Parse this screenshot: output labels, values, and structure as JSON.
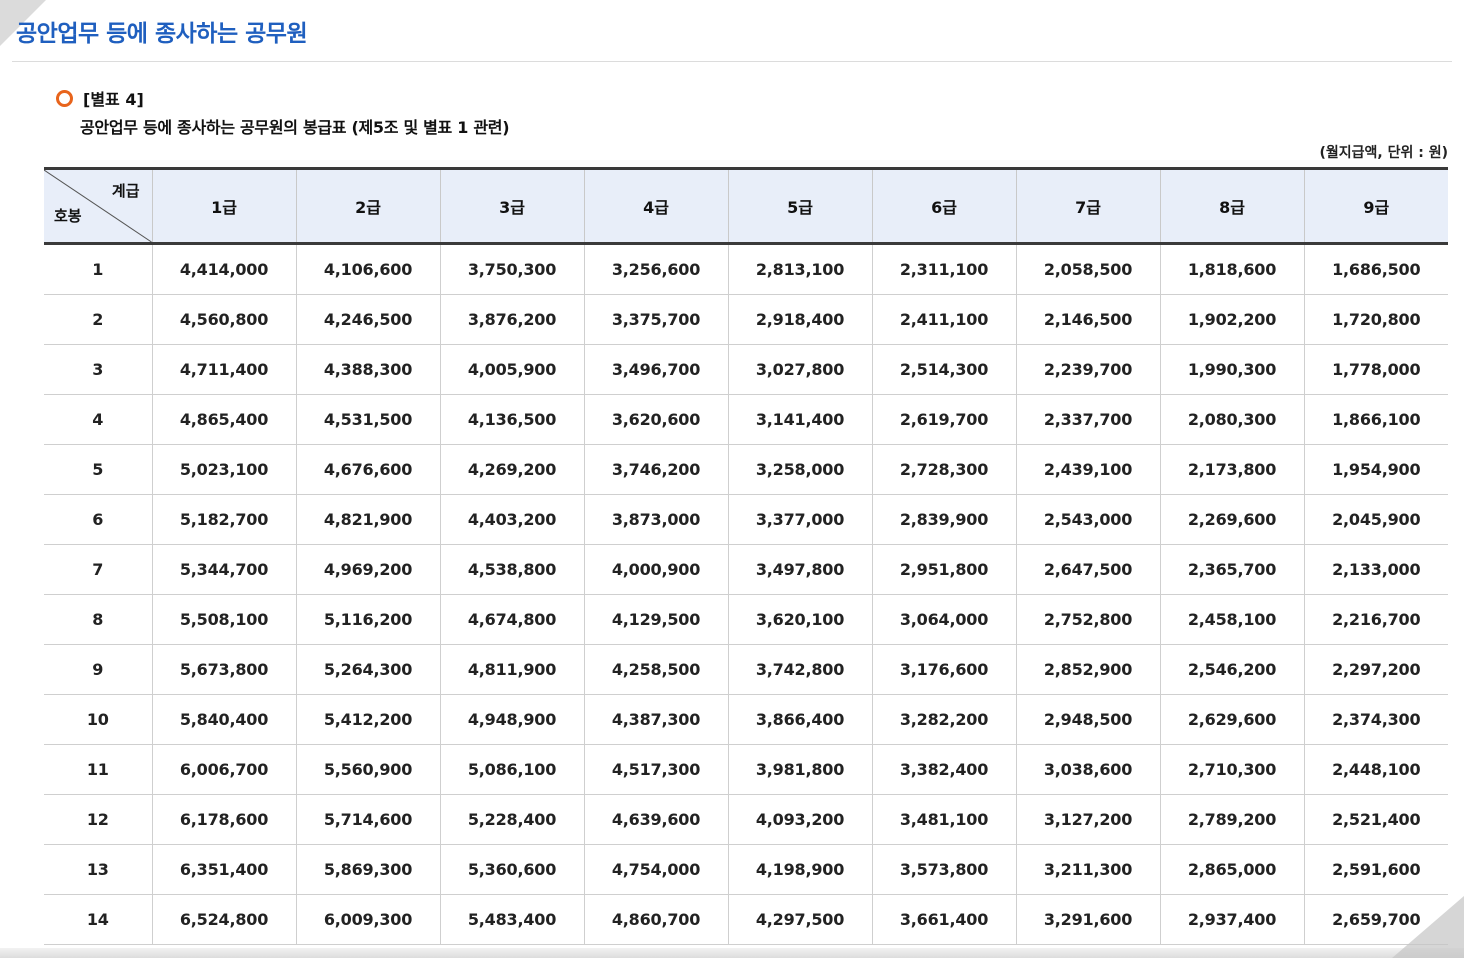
{
  "page": {
    "title": "공안업무 등에 종사하는 공무원",
    "ref": "[별표 4]",
    "caption": "공안업무 등에 종사하는 공무원의 봉급표 (제5조 및 별표 1 관련)",
    "unit_note": "(월지급액, 단위 : 원)",
    "accent_color": "#1f5fbf"
  },
  "table": {
    "corner_top": "계급",
    "corner_bottom": "호봉",
    "headers": [
      "1급",
      "2급",
      "3급",
      "4급",
      "5급",
      "6급",
      "7급",
      "8급",
      "9급"
    ],
    "rows": [
      {
        "step": "1",
        "values": [
          "4,414,000",
          "4,106,600",
          "3,750,300",
          "3,256,600",
          "2,813,100",
          "2,311,100",
          "2,058,500",
          "1,818,600",
          "1,686,500"
        ]
      },
      {
        "step": "2",
        "values": [
          "4,560,800",
          "4,246,500",
          "3,876,200",
          "3,375,700",
          "2,918,400",
          "2,411,100",
          "2,146,500",
          "1,902,200",
          "1,720,800"
        ]
      },
      {
        "step": "3",
        "values": [
          "4,711,400",
          "4,388,300",
          "4,005,900",
          "3,496,700",
          "3,027,800",
          "2,514,300",
          "2,239,700",
          "1,990,300",
          "1,778,000"
        ]
      },
      {
        "step": "4",
        "values": [
          "4,865,400",
          "4,531,500",
          "4,136,500",
          "3,620,600",
          "3,141,400",
          "2,619,700",
          "2,337,700",
          "2,080,300",
          "1,866,100"
        ]
      },
      {
        "step": "5",
        "values": [
          "5,023,100",
          "4,676,600",
          "4,269,200",
          "3,746,200",
          "3,258,000",
          "2,728,300",
          "2,439,100",
          "2,173,800",
          "1,954,900"
        ]
      },
      {
        "step": "6",
        "values": [
          "5,182,700",
          "4,821,900",
          "4,403,200",
          "3,873,000",
          "3,377,000",
          "2,839,900",
          "2,543,000",
          "2,269,600",
          "2,045,900"
        ]
      },
      {
        "step": "7",
        "values": [
          "5,344,700",
          "4,969,200",
          "4,538,800",
          "4,000,900",
          "3,497,800",
          "2,951,800",
          "2,647,500",
          "2,365,700",
          "2,133,000"
        ]
      },
      {
        "step": "8",
        "values": [
          "5,508,100",
          "5,116,200",
          "4,674,800",
          "4,129,500",
          "3,620,100",
          "3,064,000",
          "2,752,800",
          "2,458,100",
          "2,216,700"
        ]
      },
      {
        "step": "9",
        "values": [
          "5,673,800",
          "5,264,300",
          "4,811,900",
          "4,258,500",
          "3,742,800",
          "3,176,600",
          "2,852,900",
          "2,546,200",
          "2,297,200"
        ]
      },
      {
        "step": "10",
        "values": [
          "5,840,400",
          "5,412,200",
          "4,948,900",
          "4,387,300",
          "3,866,400",
          "3,282,200",
          "2,948,500",
          "2,629,600",
          "2,374,300"
        ]
      },
      {
        "step": "11",
        "values": [
          "6,006,700",
          "5,560,900",
          "5,086,100",
          "4,517,300",
          "3,981,800",
          "3,382,400",
          "3,038,600",
          "2,710,300",
          "2,448,100"
        ]
      },
      {
        "step": "12",
        "values": [
          "6,178,600",
          "5,714,600",
          "5,228,400",
          "4,639,600",
          "4,093,200",
          "3,481,100",
          "3,127,200",
          "2,789,200",
          "2,521,400"
        ]
      },
      {
        "step": "13",
        "values": [
          "6,351,400",
          "5,869,300",
          "5,360,600",
          "4,754,000",
          "4,198,900",
          "3,573,800",
          "3,211,300",
          "2,865,000",
          "2,591,600"
        ]
      },
      {
        "step": "14",
        "values": [
          "6,524,800",
          "6,009,300",
          "5,483,400",
          "4,860,700",
          "4,297,500",
          "3,661,400",
          "3,291,600",
          "2,937,400",
          "2,659,700"
        ]
      }
    ]
  }
}
